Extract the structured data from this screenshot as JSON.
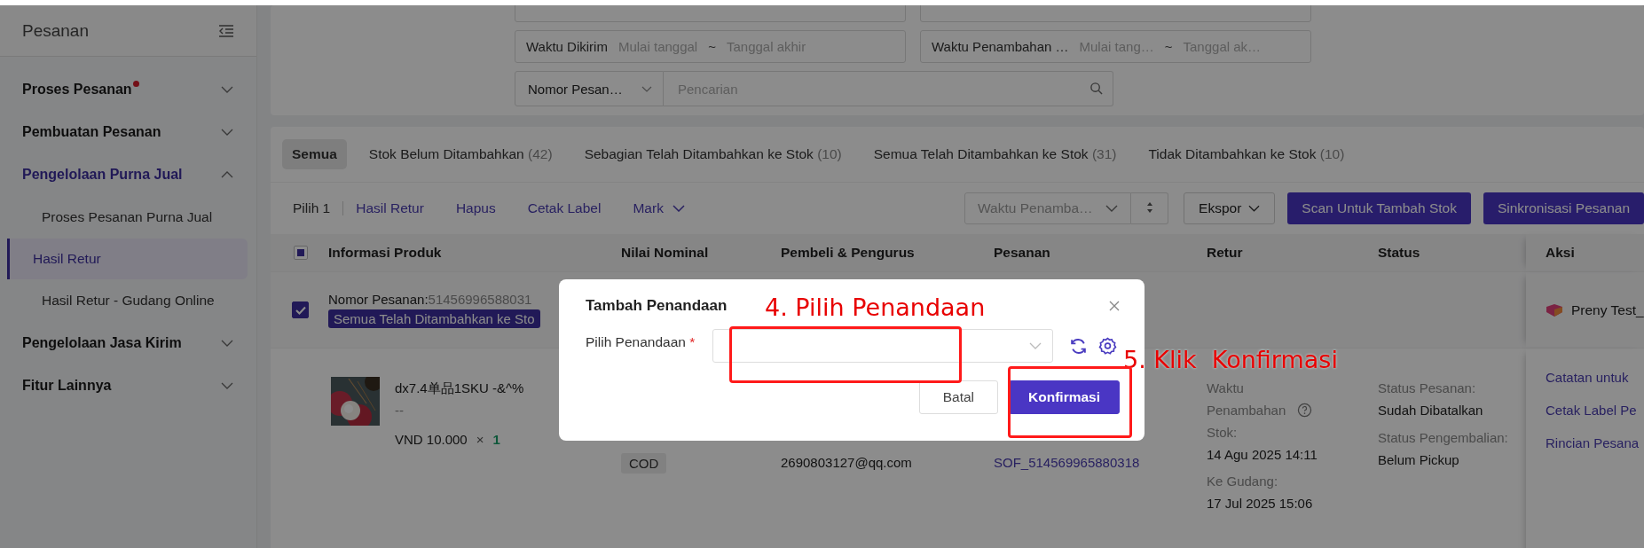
{
  "sidebar": {
    "title": "Pesanan",
    "items": [
      {
        "label": "Proses Pesanan",
        "notification": true,
        "expanded": false,
        "selected": false
      },
      {
        "label": "Pembuatan Pesanan",
        "notification": false,
        "expanded": false,
        "selected": false
      },
      {
        "label": "Pengelolaan Purna Jual",
        "notification": false,
        "expanded": true,
        "selected": true,
        "children": [
          {
            "label": "Proses Pesanan Purna Jual",
            "selected": false
          },
          {
            "label": "Hasil Retur",
            "selected": true
          },
          {
            "label": "Hasil Retur - Gudang Online",
            "selected": false
          }
        ]
      },
      {
        "label": "Pengelolaan Jasa Kirim",
        "notification": false,
        "expanded": false,
        "selected": false
      },
      {
        "label": "Fitur Lainnya",
        "notification": false,
        "expanded": false,
        "selected": false
      }
    ]
  },
  "filters": [
    {
      "label": "Waktu Dikirim",
      "start_placeholder": "Mulai tanggal",
      "separator": "~",
      "end_placeholder": "Tanggal akhir"
    },
    {
      "label": "Waktu Penambahan …",
      "start_placeholder": "Mulai tang…",
      "separator": "~",
      "end_placeholder": "Tanggal ak…"
    }
  ],
  "search": {
    "field": "Nomor Pesan…",
    "placeholder": "Pencarian"
  },
  "tabs": [
    {
      "label": "Semua",
      "selected": true
    },
    {
      "label": "Stok Belum Ditambahkan",
      "count": "(42)",
      "selected": false
    },
    {
      "label": "Sebagian Telah Ditambahkan ke Stok",
      "count": "(10)",
      "selected": false
    },
    {
      "label": "Semua Telah Ditambahkan ke Stok",
      "count": "(31)",
      "selected": false
    },
    {
      "label": "Tidak Ditambahkan ke Stok",
      "count": "(10)",
      "selected": false
    }
  ],
  "toolbar": {
    "selection": "Pilih 1",
    "actions": [
      {
        "label": "Hasil Retur",
        "kind": "link"
      },
      {
        "label": "Hapus",
        "kind": "link"
      },
      {
        "label": "Cetak Label",
        "kind": "link"
      },
      {
        "label": "Mark",
        "kind": "dropdown"
      }
    ],
    "sort": "Waktu Penamba…",
    "export": "Ekspor",
    "buttons": [
      "Scan Untuk Tambah Stok",
      "Sinkronisasi Pesanan"
    ]
  },
  "table": {
    "select_all_indeterminate": true,
    "columns": [
      "Informasi Produk",
      "Nilai Nominal",
      "Pembeli & Pengurus",
      "Pesanan",
      "Retur",
      "Status",
      "Aksi"
    ],
    "order": {
      "checked": true,
      "order_label": "Nomor Pesanan:",
      "order_number": "51456996588031",
      "tag": "Semua Telah Ditambahkan ke Sto",
      "shop": "Preny Test_",
      "product": {
        "name": "dx7.4单品1SKU -&^%",
        "variant": "--",
        "price": "VND 10.000",
        "times": "×",
        "quantity": "1"
      },
      "payment": "COD",
      "buyer": "2690803127@qq.com",
      "tracking": "SOF_514569965880318",
      "return": [
        {
          "label": "Waktu Penambahan Stok:",
          "value": "14 Agu 2025 14:11",
          "help": true
        },
        {
          "label": "Ke Gudang:",
          "value": "17 Jul 2025 15:06",
          "help": false
        }
      ],
      "status": [
        {
          "label": "Status Pesanan:",
          "value": "Sudah Dibatalkan"
        },
        {
          "label": "Status Pengembalian:",
          "value": "Belum Pickup"
        }
      ],
      "actions": [
        "Catatan untuk",
        "Cetak Label Pe",
        "Rincian Pesana"
      ]
    }
  },
  "dialog": {
    "title": "Tambah Penandaan",
    "field_label": "Pilih Penandaan",
    "required_mark": "*",
    "buttons": [
      {
        "label": "Batal",
        "kind": "secondary"
      },
      {
        "label": "Konfirmasi",
        "kind": "primary"
      }
    ]
  },
  "annotations": [
    {
      "text": "4. Pilih Penandaan"
    },
    {
      "text": "5. Klik  Konfirmasi"
    }
  ]
}
